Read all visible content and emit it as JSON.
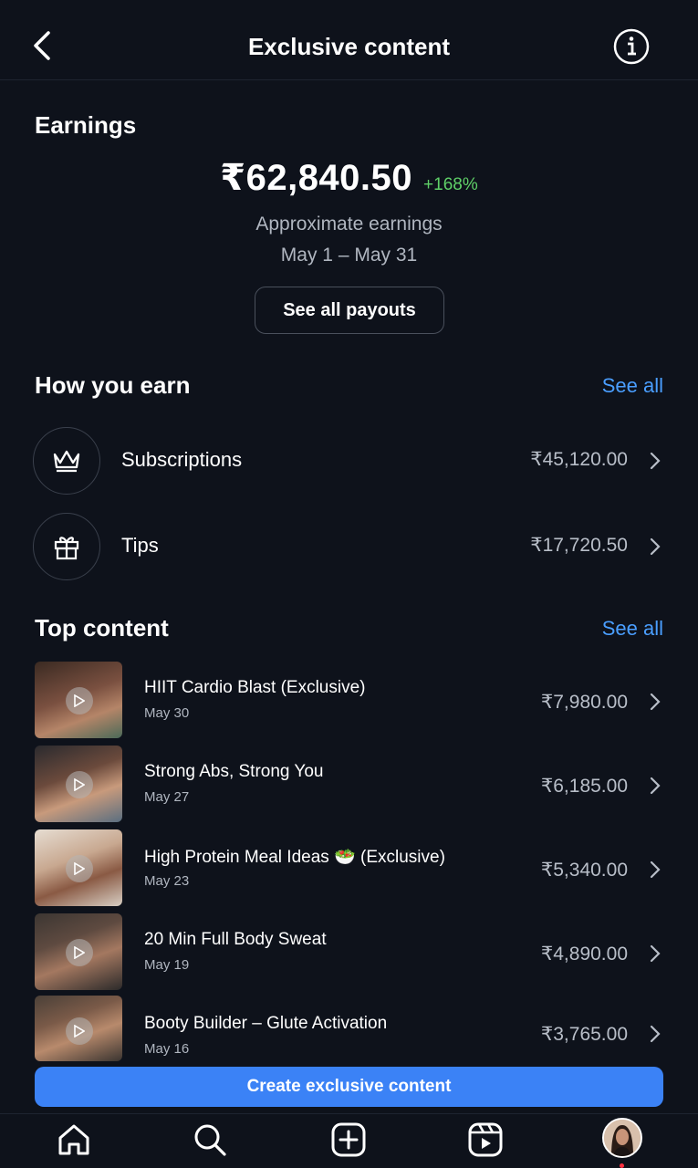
{
  "header": {
    "title": "Exclusive content"
  },
  "earnings": {
    "section_title": "Earnings",
    "amount": "₹62,840.50",
    "growth": "+168%",
    "approx_label": "Approximate earnings",
    "period": "May 1 – May 31",
    "payouts_button": "See all payouts"
  },
  "how_you_earn": {
    "title": "How you earn",
    "see_all": "See all",
    "items": [
      {
        "label": "Subscriptions",
        "value": "₹45,120.00",
        "icon": "crown-icon"
      },
      {
        "label": "Tips",
        "value": "₹17,720.50",
        "icon": "gift-icon"
      }
    ]
  },
  "top_content": {
    "title": "Top content",
    "see_all": "See all",
    "items": [
      {
        "title": "HIIT Cardio Blast (Exclusive)",
        "date": "May 30",
        "value": "₹7,980.00"
      },
      {
        "title": "Strong Abs, Strong You",
        "date": "May 27",
        "value": "₹6,185.00"
      },
      {
        "title": "High Protein Meal Ideas 🥗 (Exclusive)",
        "date": "May 23",
        "value": "₹5,340.00"
      },
      {
        "title": "20 Min Full Body Sweat",
        "date": "May 19",
        "value": "₹4,890.00"
      },
      {
        "title": "Booty Builder – Glute Activation",
        "date": "May 16",
        "value": "₹3,765.00"
      }
    ]
  },
  "create_button": "Create exclusive content",
  "nav": [
    "home-icon",
    "search-icon",
    "create-icon",
    "reels-icon",
    "profile-avatar"
  ],
  "colors": {
    "background": "#0e121b",
    "accent": "#3b82f6",
    "link": "#4a9eff",
    "growth": "#5fd068"
  }
}
